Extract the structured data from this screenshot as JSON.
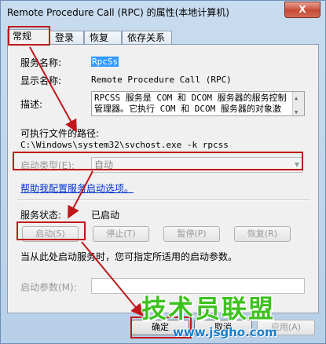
{
  "window": {
    "title": "Remote Procedure Call (RPC) 的属性(本地计算机)",
    "close_label": "X"
  },
  "tabs": [
    {
      "label": "常规"
    },
    {
      "label": "登录"
    },
    {
      "label": "恢复"
    },
    {
      "label": "依存关系"
    }
  ],
  "general": {
    "service_name_label": "服务名称:",
    "service_name_value": "RpcSs",
    "display_name_label": "显示名称:",
    "display_name_value": "Remote Procedure Call (RPC)",
    "description_label": "描述:",
    "description_lines": [
      "RPCSS 服务是 COM 和 DCOM 服务器的服务控制",
      "管理器。它执行 COM 和 DCOM 服务器的对象激"
    ],
    "exe_path_label": "可执行文件的路径:",
    "exe_path_value": "C:\\Windows\\system32\\svchost.exe -k rpcss",
    "startup_type_label": "启动类型(E):",
    "startup_type_value": "自动",
    "help_link": "帮助我配置服务启动选项。",
    "service_status_label": "服务状态:",
    "service_status_value": "已启动",
    "start_btn": "启动(S)",
    "stop_btn": "停止(T)",
    "pause_btn": "暂停(P)",
    "resume_btn": "恢复(R)",
    "hint_text": "当从此处启动服务时，您可指定所适用的启动参数。",
    "start_params_label": "启动参数(M):",
    "start_params_value": ""
  },
  "footer": {
    "ok_btn": "确定",
    "cancel_btn": "取消",
    "apply_btn": "应用(A)"
  },
  "watermark": {
    "title": "技术员联盟",
    "url": "www.jsgho.com"
  },
  "colors": {
    "annotation_red": "#c0171b",
    "watermark_green": "#3ec21f",
    "watermark_blue": "#1c7ec9"
  }
}
